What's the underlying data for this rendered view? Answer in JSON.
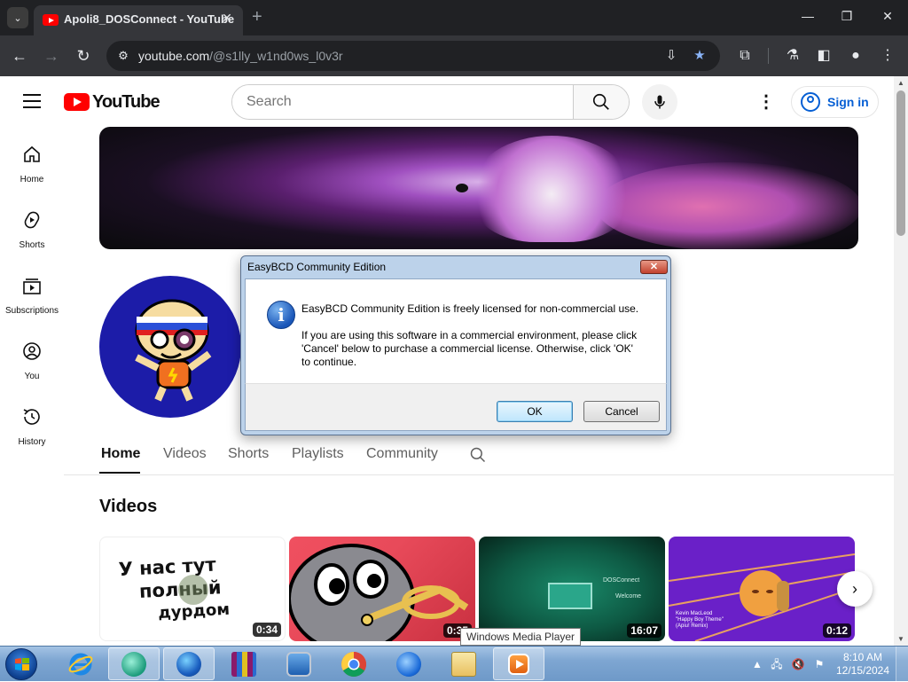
{
  "browser": {
    "tab_title": "Apoli8_DOSConnect - YouTube",
    "url_host": "youtube.com",
    "url_path": "/@s1lly_w1nd0ws_l0v3r"
  },
  "youtube": {
    "logo_text": "YouTube",
    "search_placeholder": "Search",
    "sign_in": "Sign in",
    "guide": [
      {
        "label": "Home",
        "icon": "home-icon"
      },
      {
        "label": "Shorts",
        "icon": "shorts-icon"
      },
      {
        "label": "Subscriptions",
        "icon": "subscriptions-icon"
      },
      {
        "label": "You",
        "icon": "you-icon"
      },
      {
        "label": "History",
        "icon": "history-icon"
      }
    ],
    "channel_tabs": [
      "Home",
      "Videos",
      "Shorts",
      "Playlists",
      "Community"
    ],
    "section_title": "Videos",
    "videos": [
      {
        "duration": "0:34",
        "thumb_text": [
          "У нас тут",
          "полный",
          "дурдом"
        ]
      },
      {
        "duration": "0:35"
      },
      {
        "duration": "16:07",
        "thumb_text": [
          "DOSConnect",
          "Welcome"
        ]
      },
      {
        "duration": "0:12",
        "thumb_text": [
          "Kevin MacLeod",
          "\"Happy Boy Theme\"",
          "(Apiu! Remix)"
        ]
      }
    ]
  },
  "dialog": {
    "title": "EasyBCD Community Edition",
    "close_label": "✕",
    "message_line1": "EasyBCD Community Edition is freely licensed for non-commercial use.",
    "message_para": [
      "If you are using this software in a commercial environment, please click",
      "'Cancel' below to purchase a commercial license. Otherwise, click 'OK'",
      "to continue."
    ],
    "ok": "OK",
    "cancel": "Cancel"
  },
  "taskbar": {
    "tooltip": "Windows Media Player",
    "time": "8:10 AM",
    "date": "12/15/2024",
    "apps": [
      "internet-explorer",
      "app-bubble",
      "network-app",
      "winrar",
      "computer-app",
      "chrome",
      "thunderbird",
      "file-explorer",
      "windows-media-player"
    ]
  },
  "colors": {
    "youtube_red": "#ff0000",
    "link_blue": "#065fd4",
    "chrome_dark": "#202124",
    "taskbar_blue": "#7ea6d2"
  }
}
